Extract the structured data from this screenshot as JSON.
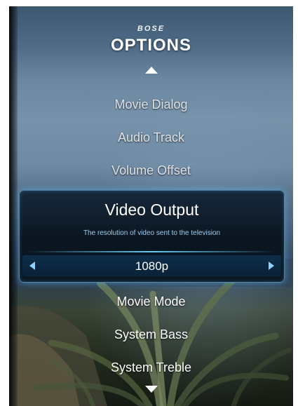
{
  "header": {
    "brand": "BOSE",
    "title": "OPTIONS"
  },
  "menu": {
    "items": [
      {
        "label": "Movie Dialog"
      },
      {
        "label": "Audio Track"
      },
      {
        "label": "Volume Offset"
      },
      {
        "label": "Video Output"
      },
      {
        "label": "Movie Mode"
      },
      {
        "label": "System Bass"
      },
      {
        "label": "System Treble"
      }
    ],
    "selected_index": 3
  },
  "selected": {
    "label": "Video Output",
    "description": "The resolution of video sent to the television",
    "value": "1080p"
  },
  "icons": {
    "scroll_up": "triangle-up-icon",
    "scroll_down": "triangle-down-icon",
    "value_prev": "triangle-left-icon",
    "value_next": "triangle-right-icon"
  },
  "colors": {
    "highlight_glow": "#5abeff",
    "selected_bg": "#0a1520",
    "description_text": "#9ccaf0"
  }
}
